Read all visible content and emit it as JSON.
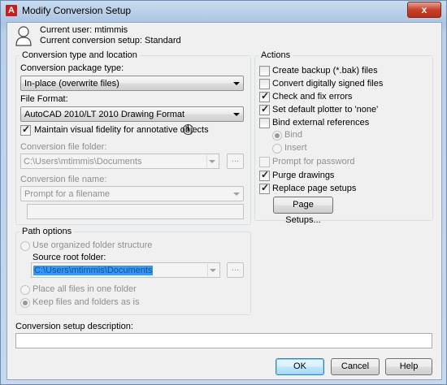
{
  "window": {
    "app_icon": "A",
    "title": "Modify Conversion Setup",
    "close_glyph": "x"
  },
  "user_info": {
    "current_user": "Current user: mtimmis",
    "current_setup": "Current conversion setup: Standard"
  },
  "conversion_group": {
    "title": "Conversion type and location",
    "package_type_label": "Conversion package type:",
    "package_type_value": "In-place (overwrite files)",
    "file_format_label": "File Format:",
    "file_format_value": "AutoCAD 2010/LT 2010 Drawing Format",
    "maintain_fidelity_label": "Maintain visual fidelity for annotative objects",
    "maintain_fidelity_checked": true,
    "file_folder_label": "Conversion file folder:",
    "file_folder_value": "C:\\Users\\mtimmis\\Documents",
    "file_folder_browse": "...",
    "file_name_label": "Conversion file name:",
    "file_name_value": "Prompt for a filename",
    "file_name_text": ""
  },
  "path_group": {
    "title": "Path options",
    "use_organized_label": "Use organized folder structure",
    "source_root_label": "Source root folder:",
    "source_root_value": "C:\\Users\\mtimmis\\Documents",
    "source_root_browse": "...",
    "place_all_label": "Place all files in one folder",
    "keep_files_label": "Keep files and folders as is",
    "selected_option": "keep"
  },
  "actions_group": {
    "title": "Actions",
    "items": [
      {
        "label": "Create backup (*.bak) files",
        "checked": false,
        "disabled": false
      },
      {
        "label": "Convert digitally signed files",
        "checked": false,
        "disabled": false
      },
      {
        "label": "Check and fix errors",
        "checked": true,
        "disabled": false
      },
      {
        "label": "Set default plotter to 'none'",
        "checked": true,
        "disabled": false
      },
      {
        "label": "Bind external references",
        "checked": false,
        "disabled": false
      },
      {
        "label": "Prompt for password",
        "checked": false,
        "disabled": true
      },
      {
        "label": "Purge drawings",
        "checked": true,
        "disabled": false
      },
      {
        "label": "Replace page setups",
        "checked": true,
        "disabled": false
      }
    ],
    "bind_option": "Bind",
    "insert_option": "Insert",
    "page_setups_button": "Page Setups..."
  },
  "description": {
    "label": "Conversion setup description:",
    "value": ""
  },
  "buttons": {
    "ok": "OK",
    "cancel": "Cancel",
    "help": "Help"
  },
  "colors": {
    "title_bar": "#b9d0ea",
    "close_button": "#c7412a",
    "selection": "#3399ff",
    "dialog_bg": "#f0f0f0"
  }
}
